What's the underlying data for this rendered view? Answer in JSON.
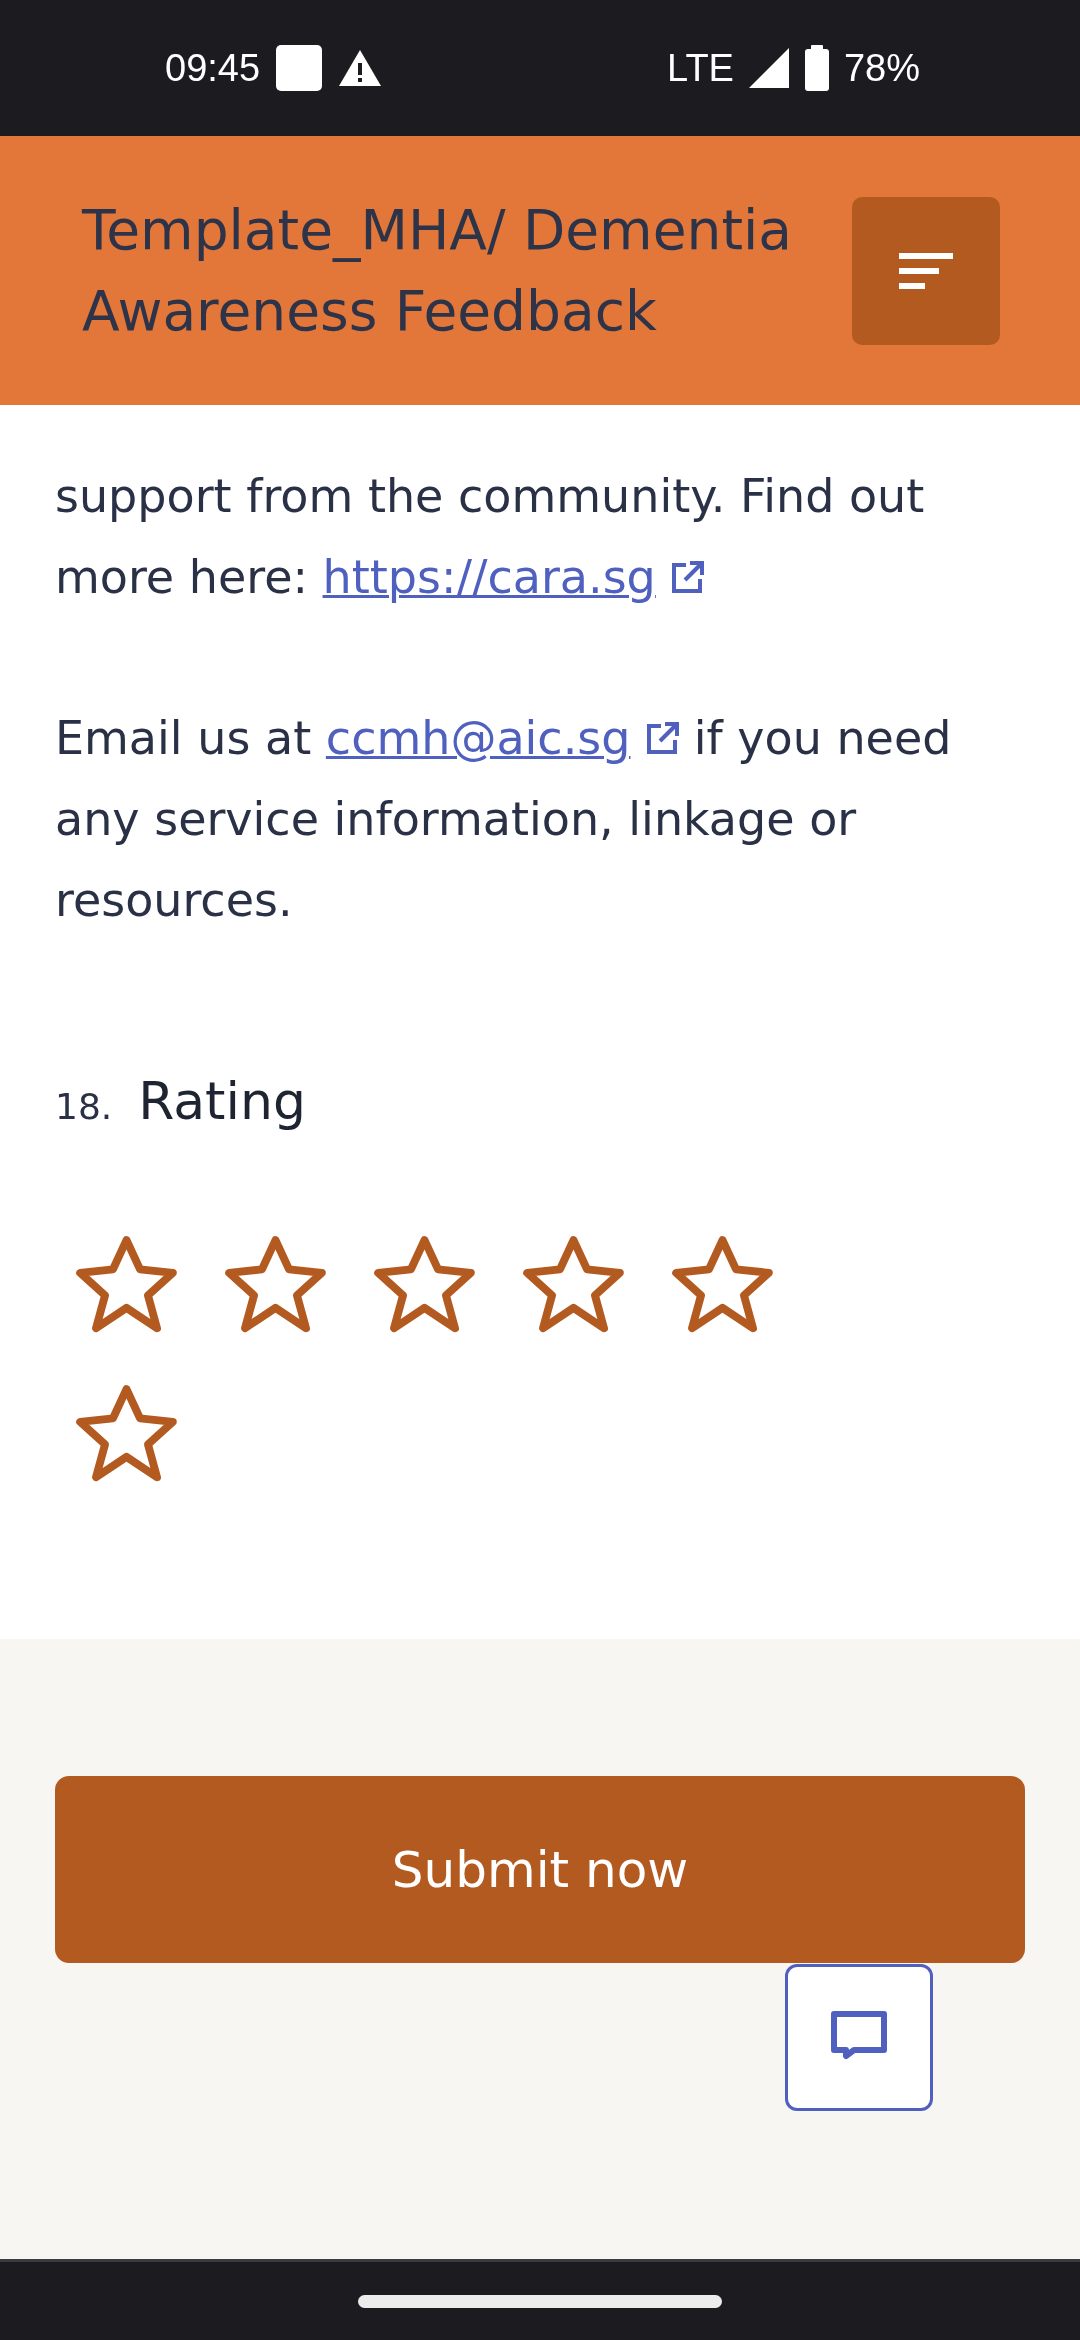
{
  "status_bar": {
    "time": "09:45",
    "network": "LTE",
    "battery": "78%"
  },
  "header": {
    "title": "Template_MHA/ Dementia Awareness Feedback"
  },
  "paragraphs": [
    {
      "parts": [
        {
          "kind": "text",
          "text": "support from the community. Find out more here: "
        },
        {
          "kind": "link",
          "text": "https://cara.sg"
        }
      ]
    },
    {
      "parts": [
        {
          "kind": "text",
          "text": "Email us at "
        },
        {
          "kind": "link",
          "text": "ccmh@aic.sg"
        },
        {
          "kind": "text",
          "text": " if you need any service information, linkage or resources."
        }
      ]
    }
  ],
  "question": {
    "number": "18.",
    "title": "Rating",
    "stars": 0,
    "options": [
      {
        "selected": false
      },
      {
        "selected": false
      },
      {
        "selected": false
      },
      {
        "selected": false
      },
      {
        "selected": false
      },
      {
        "selected": false
      }
    ]
  },
  "submit_button": {
    "label": "Submit now"
  }
}
